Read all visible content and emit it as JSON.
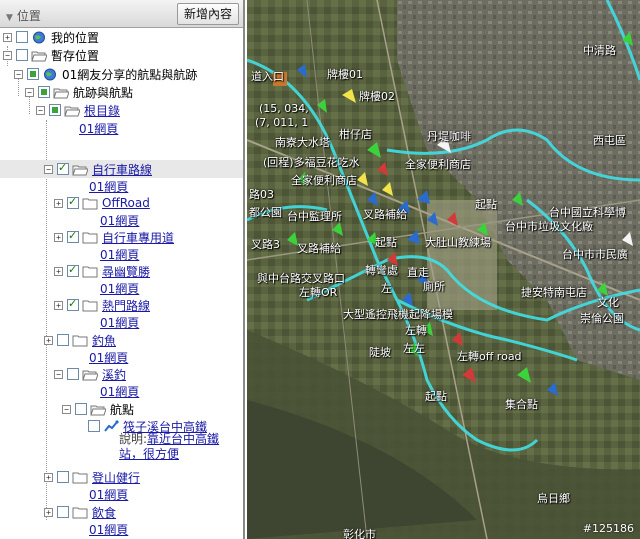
{
  "panel": {
    "title": "位置",
    "add_button": "新增內容"
  },
  "tree": {
    "my_places": "我的位置",
    "temp_places": "暫存位置",
    "shared_kmz": "01網友分享的航點與航跡",
    "tracks_waypoints": "航跡與航點",
    "root": "根目錄",
    "page01": "01網頁",
    "bike_routes": "自行車路線",
    "offroad": "OffRoad",
    "bike_lane": "自行車專用道",
    "secluded": "尋幽覽勝",
    "popular": "熱門路線",
    "fishing": "釣魚",
    "river_fishing": "溪釣",
    "waypoint": "航點",
    "waypoint_item": "筏子溪台中高鐵",
    "desc_label": "說明:",
    "desc_text": "靠近台中高鐵站，很方便",
    "hiking": "登山健行",
    "food": "飲食"
  },
  "map": {
    "labels": {
      "entrance": "道入口",
      "sign01": "牌樓01",
      "sign02": "牌樓02",
      "coords": "(15, 034,",
      "coords2": "(7, 011, 1",
      "water_tower": "南寮大水塔",
      "orange_shop": "柑仔店",
      "danti_coffee": "丹堤咖啡",
      "zhongqing": "中清路",
      "xitun": "西屯區",
      "cafe_turn": "(回程)多福豆花吃水",
      "family_mart": "全家便利商店",
      "family_mart2": "全家便利商店",
      "shop": "利商店",
      "road03": "路03",
      "park": "都公園",
      "prison": "台中監理所",
      "fork_supply": "叉路補給",
      "fork_supply2": "叉路補給",
      "start": "起點",
      "start2": "起點",
      "start3": "起點",
      "taizhong_city": "台中市",
      "rubbish": "台中市垃圾文化廠",
      "tzu_cheng": "台中國立科學博",
      "fork_road3": "叉路3",
      "dadu_school": "大肚山教練場",
      "turn_right": "轉彎處",
      "direct": "直走",
      "taizhong_city2": "台中市市民廣",
      "intersection": "與中台路交叉路口",
      "left_or": "左轉OR",
      "left_toilet": "廁所",
      "toilet_left": "左",
      "jiean": "捷安特南屯店",
      "culture": "文化",
      "chongguo": "崇倫公園",
      "airport": "大型遙控飛機起降場模",
      "left_turn": "左轉",
      "slope": "陡坡",
      "left_turn2": "左左",
      "left_offroad": "左轉off road",
      "start_pt": "起點",
      "meet_pt": "集合點",
      "wuri": "烏日鄉",
      "changhua": "彰化市",
      "nantun": "南屯"
    },
    "watermark": "#125186"
  },
  "colors": {
    "route": "#3fe0e6",
    "link": "#1a1aa6"
  }
}
